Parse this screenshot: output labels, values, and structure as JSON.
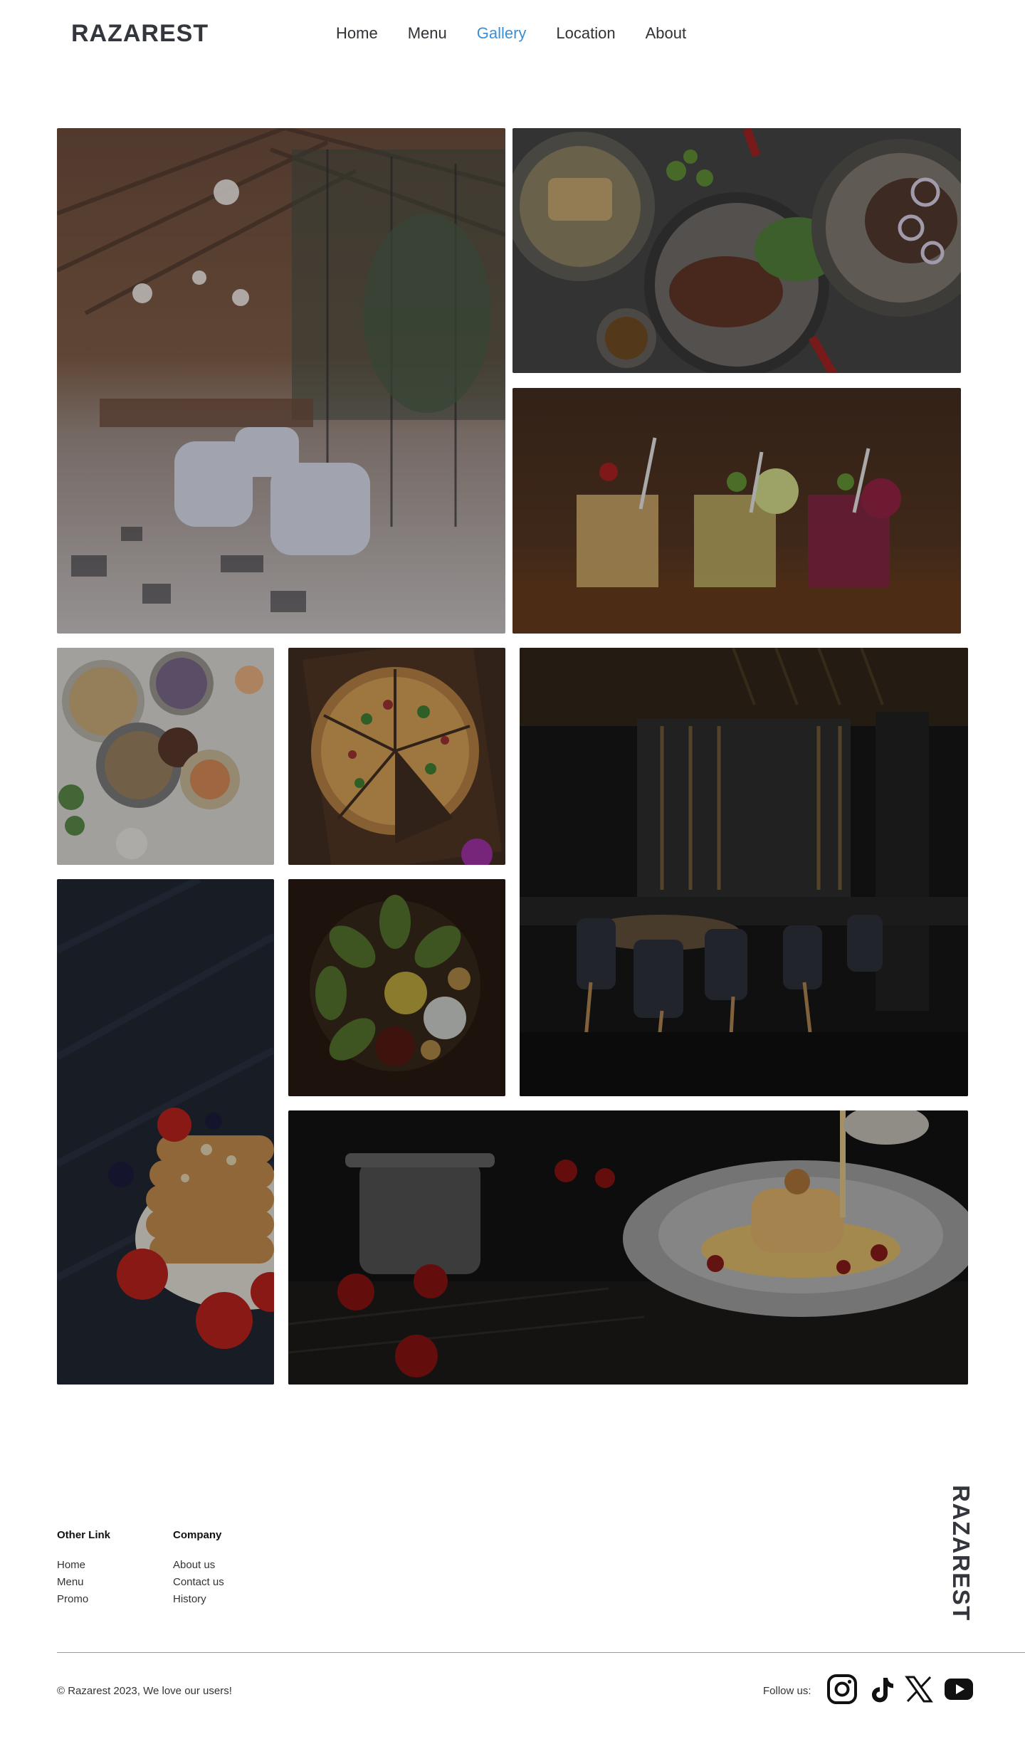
{
  "header": {
    "brand": "RAZAREST",
    "nav": [
      {
        "label": "Home",
        "active": false
      },
      {
        "label": "Menu",
        "active": false
      },
      {
        "label": "Gallery",
        "active": true
      },
      {
        "label": "Location",
        "active": false
      },
      {
        "label": "About",
        "active": false
      }
    ]
  },
  "gallery": {
    "images": [
      {
        "name": "restaurant-interior-greenhouse-photo",
        "kind": "interior-bright"
      },
      {
        "name": "grilled-steak-plates-photo",
        "kind": "plates"
      },
      {
        "name": "cocktails-bar-photo",
        "kind": "cocktails"
      },
      {
        "name": "breakfast-bowls-photo",
        "kind": "bowls"
      },
      {
        "name": "pizza-photo",
        "kind": "pizza"
      },
      {
        "name": "dark-restaurant-dining-room-photo",
        "kind": "interior-dark"
      },
      {
        "name": "pancake-stack-photo",
        "kind": "pancakes"
      },
      {
        "name": "tacos-platter-photo",
        "kind": "tacos"
      },
      {
        "name": "dessert-sauce-pour-photo",
        "kind": "dessert"
      }
    ]
  },
  "footer": {
    "other_link": {
      "title": "Other Link",
      "links": [
        "Home",
        "Menu",
        "Promo"
      ]
    },
    "company": {
      "title": "Company",
      "links": [
        "About us",
        "Contact us",
        "History"
      ]
    },
    "vertical_brand": "RAZAREST",
    "copyright": "© Razarest 2023, We love our users!",
    "follow_label": "Follow us:",
    "social": [
      "instagram-icon",
      "tiktok-icon",
      "x-icon",
      "youtube-icon"
    ]
  },
  "colors": {
    "accent": "#3b8fd6",
    "text": "#2f3237",
    "divider": "#9a9a9a"
  }
}
